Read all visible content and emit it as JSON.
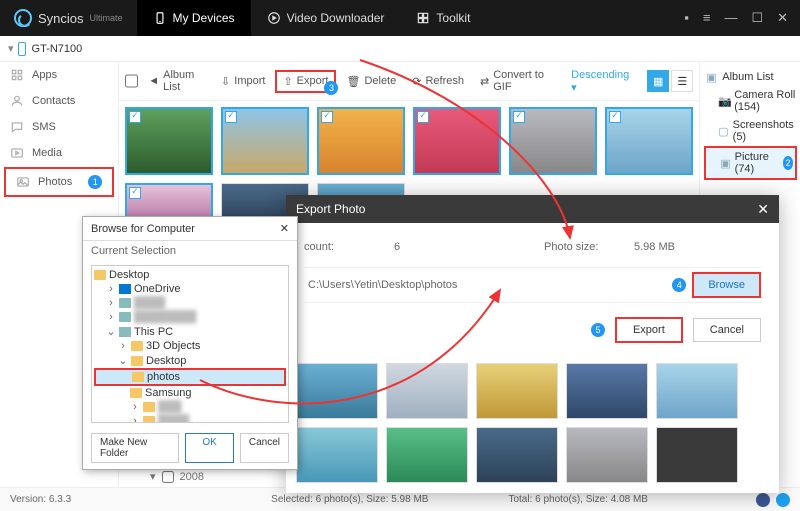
{
  "app": {
    "name": "Syncios",
    "edition": "Ultimate"
  },
  "nav": {
    "my_devices": "My Devices",
    "video_downloader": "Video Downloader",
    "toolkit": "Toolkit"
  },
  "device": {
    "name": "GT-N7100"
  },
  "sidebar": {
    "apps": "Apps",
    "contacts": "Contacts",
    "sms": "SMS",
    "media": "Media",
    "photos": "Photos",
    "photos_badge": "1"
  },
  "toolbar": {
    "album_list": "Album List",
    "import": "Import",
    "export": "Export",
    "export_badge": "3",
    "delete": "Delete",
    "refresh": "Refresh",
    "convert_gif": "Convert to GIF",
    "sort": "Descending ▾"
  },
  "rightpanel": {
    "album_list": "Album List",
    "camera_roll": "Camera Roll (154)",
    "screenshots": "Screenshots (5)",
    "picture": "Picture (74)",
    "picture_badge": "2"
  },
  "export_dialog": {
    "title": "Export Photo",
    "count_label": "count:",
    "count_value": "6",
    "size_label": "Photo size:",
    "size_value": "5.98 MB",
    "path": "C:\\Users\\Yetin\\Desktop\\photos",
    "path_badge": "4",
    "browse": "Browse",
    "export_btn": "Export",
    "export_badge": "5",
    "cancel": "Cancel"
  },
  "browse_dialog": {
    "title": "Browse for Computer",
    "current_selection": "Current Selection",
    "desktop": "Desktop",
    "onedrive": "OneDrive",
    "this_pc": "This PC",
    "objects_3d": "3D Objects",
    "desktop2": "Desktop",
    "photos": "photos",
    "samsung": "Samsung",
    "make_new_folder": "Make New Folder",
    "ok": "OK",
    "cancel": "Cancel"
  },
  "year_label": "2008",
  "status": {
    "version": "Version: 6.3.3",
    "selected": "Selected: 6 photo(s), Size: 5.98 MB",
    "total": "Total: 6 photo(s), Size: 4.08 MB"
  }
}
